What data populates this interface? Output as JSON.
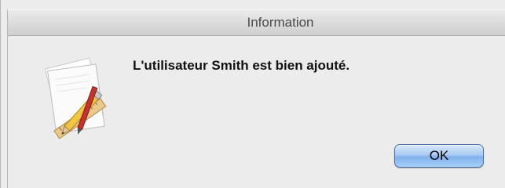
{
  "dialog": {
    "title": "Information",
    "message": "L'utilisateur Smith est bien ajouté.",
    "ok_label": "OK",
    "icon": "app-document-pencil-ruler-icon"
  },
  "colors": {
    "background": "#ececec",
    "button_blue": "#7fb1ec",
    "title_text": "#4a4a4a"
  }
}
